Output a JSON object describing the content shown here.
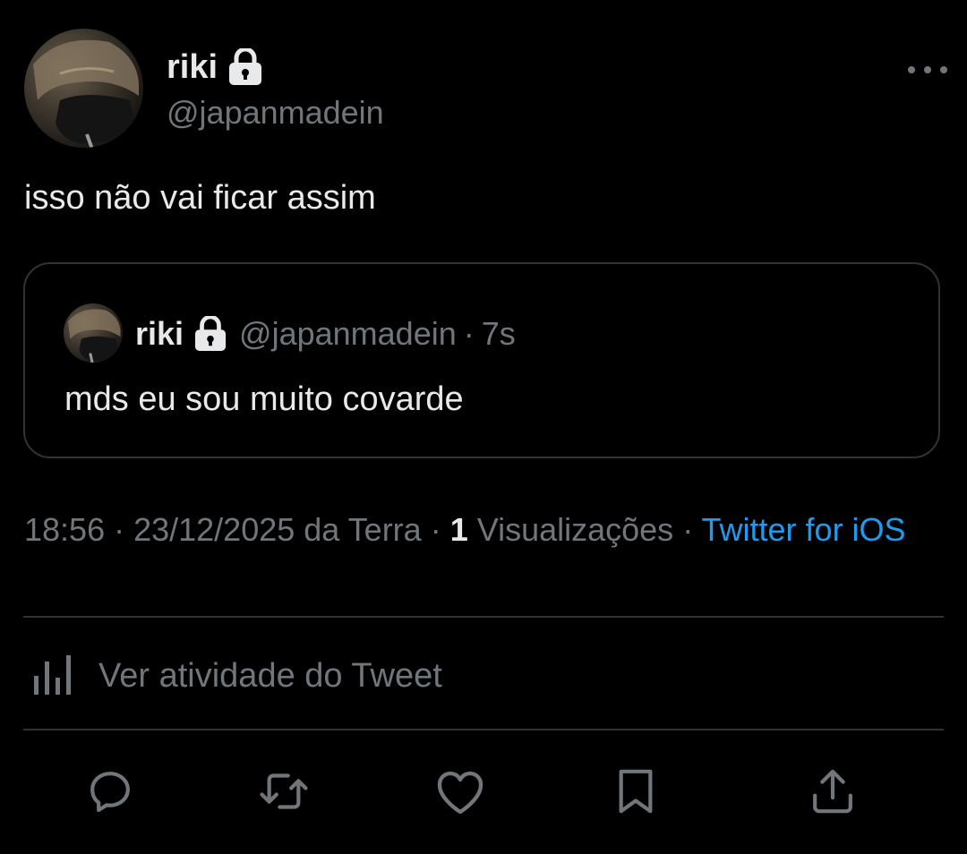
{
  "tweet": {
    "author": {
      "display_name": "riki",
      "handle": "@japanmadein",
      "avatar": "avatar-photo",
      "lock_icon": "lock-icon"
    },
    "text": "isso não vai ficar assim",
    "more_icon": "more-horizontal-icon"
  },
  "quote": {
    "display_name": "riki",
    "handle": "@japanmadein",
    "separator": "·",
    "time": "7s",
    "text": "mds eu sou muito covarde"
  },
  "meta": {
    "time": "18:56",
    "dot1": " · ",
    "date": "23/12/2025 da Terra",
    "dot2": " · ",
    "views_count": "1",
    "views_label": " Visualizações",
    "dot3": " · ",
    "client": "Twitter for iOS"
  },
  "activity": {
    "label": "Ver atividade do Tweet",
    "icon": "analytics-icon"
  },
  "actions": [
    {
      "name": "reply",
      "icon": "reply-icon"
    },
    {
      "name": "retweet",
      "icon": "retweet-icon"
    },
    {
      "name": "like",
      "icon": "heart-icon"
    },
    {
      "name": "bookmark",
      "icon": "bookmark-icon"
    },
    {
      "name": "share",
      "icon": "share-icon"
    }
  ],
  "colors": {
    "background": "#000000",
    "text_primary": "#e7e9ea",
    "text_secondary": "#71767b",
    "link": "#1d9bf0",
    "border": "#2f3336"
  }
}
